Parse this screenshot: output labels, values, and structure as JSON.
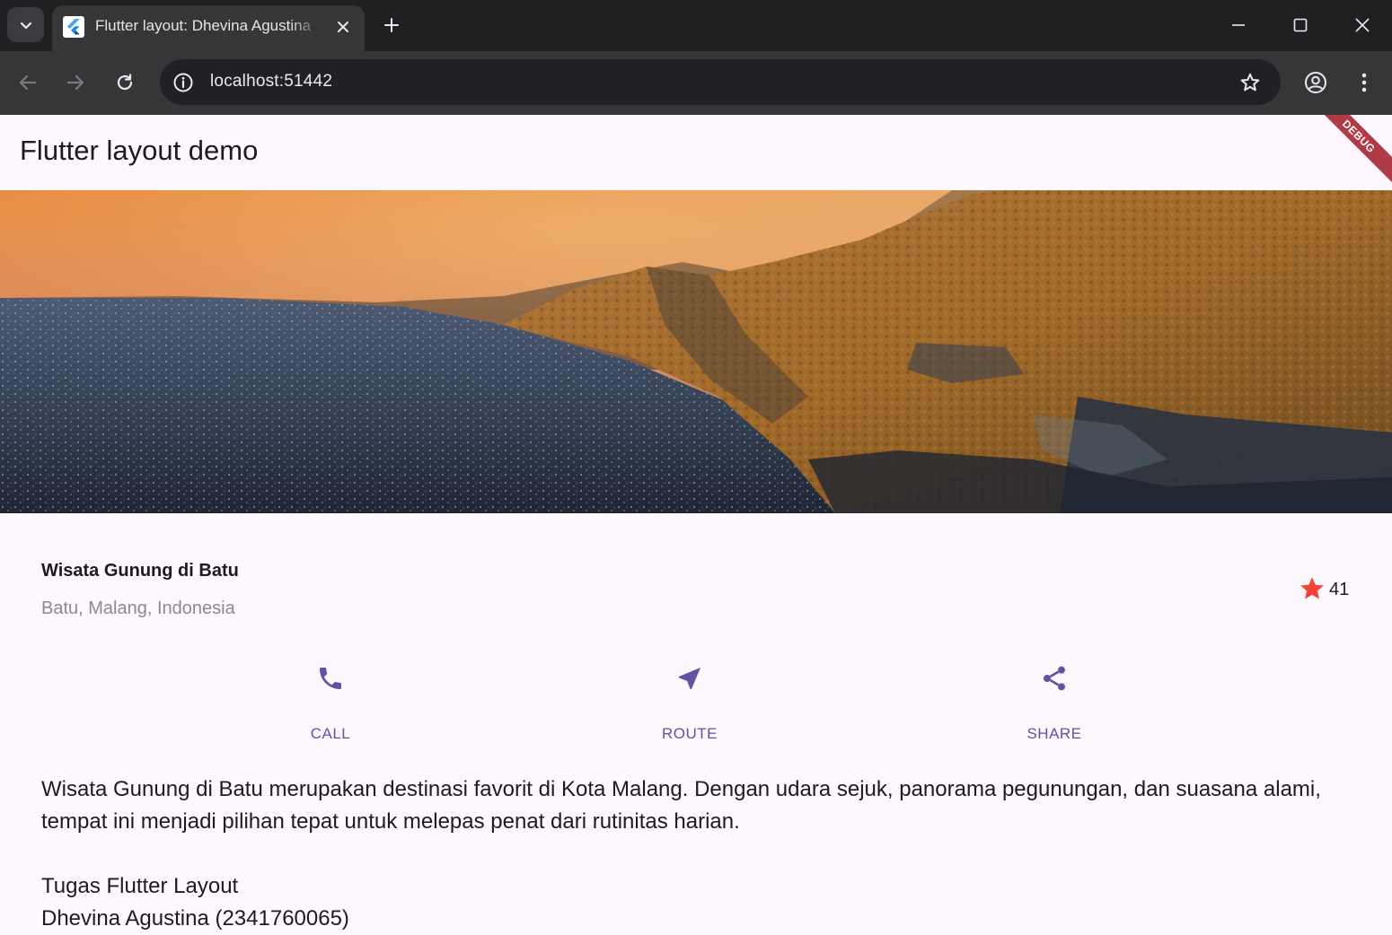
{
  "browser": {
    "tab_title": "Flutter layout: Dhevina Agustina",
    "url": "localhost:51442",
    "icons": {
      "tab_search": "chevron-down-icon",
      "favicon": "flutter-logo-icon",
      "tab_close": "close-icon",
      "new_tab": "plus-icon",
      "back": "arrow-left-icon",
      "forward": "arrow-right-icon",
      "reload": "reload-icon",
      "site_info": "info-icon",
      "bookmark": "star-outline-icon",
      "profile": "account-circle-icon",
      "menu": "more-vert-icon"
    }
  },
  "app": {
    "title": "Flutter layout demo",
    "debug_banner": "DEBUG",
    "colors": {
      "primary": "#6750a4",
      "star": "#f44336",
      "background": "#fdf7fe",
      "subtitle": "#8c8a90"
    }
  },
  "title_section": {
    "name": "Wisata Gunung di Batu",
    "location": "Batu, Malang, Indonesia",
    "rating": "41",
    "rating_icon": "star-icon"
  },
  "buttons": [
    {
      "label": "CALL",
      "icon": "call-icon"
    },
    {
      "label": "ROUTE",
      "icon": "near-me-icon"
    },
    {
      "label": "SHARE",
      "icon": "share-icon"
    }
  ],
  "text_section": {
    "description": "Wisata Gunung di Batu merupakan destinasi favorit di Kota Malang. Dengan udara sejuk, panorama pegunungan, dan suasana alami, tempat ini menjadi pilihan tepat untuk melepas penat dari rutinitas harian.",
    "assignment": "Tugas Flutter Layout",
    "author": "Dhevina Agustina (2341760065)"
  }
}
